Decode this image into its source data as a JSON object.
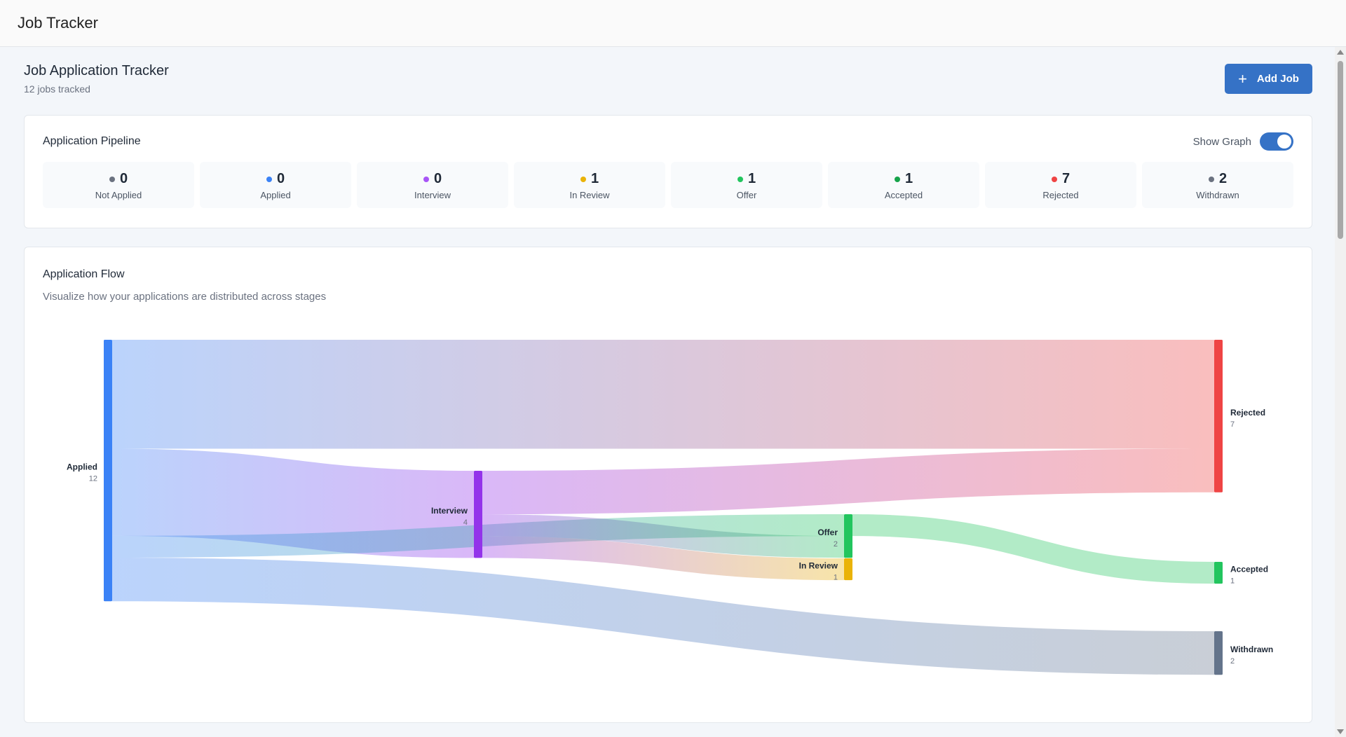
{
  "app": {
    "title": "Job Tracker"
  },
  "header": {
    "title": "Job Application Tracker",
    "subtitle": "12 jobs tracked",
    "add_button_label": "Add Job",
    "add_button_icon": "plus-icon"
  },
  "pipeline": {
    "title": "Application Pipeline",
    "toggle_label": "Show Graph",
    "toggle_on": true,
    "stages": [
      {
        "label": "Not Applied",
        "count": "0",
        "color": "#6b7280"
      },
      {
        "label": "Applied",
        "count": "0",
        "color": "#3b82f6"
      },
      {
        "label": "Interview",
        "count": "0",
        "color": "#a855f7"
      },
      {
        "label": "In Review",
        "count": "1",
        "color": "#eab308"
      },
      {
        "label": "Offer",
        "count": "1",
        "color": "#22c55e"
      },
      {
        "label": "Accepted",
        "count": "1",
        "color": "#16a34a"
      },
      {
        "label": "Rejected",
        "count": "7",
        "color": "#ef4444"
      },
      {
        "label": "Withdrawn",
        "count": "2",
        "color": "#6b7280"
      }
    ]
  },
  "flow": {
    "title": "Application Flow",
    "subtitle": "Visualize how your applications are distributed across stages"
  },
  "chart_data": {
    "type": "sankey",
    "nodes": [
      {
        "id": "applied",
        "name": "Applied",
        "value": 12,
        "color": "#3b82f6"
      },
      {
        "id": "interview",
        "name": "Interview",
        "value": 4,
        "color": "#9333ea"
      },
      {
        "id": "offer",
        "name": "Offer",
        "value": 2,
        "color": "#22c55e"
      },
      {
        "id": "inreview",
        "name": "In Review",
        "value": 1,
        "color": "#eab308"
      },
      {
        "id": "rejected",
        "name": "Rejected",
        "value": 7,
        "color": "#ef4444"
      },
      {
        "id": "accepted",
        "name": "Accepted",
        "value": 1,
        "color": "#22c55e"
      },
      {
        "id": "withdrawn",
        "name": "Withdrawn",
        "value": 2,
        "color": "#64748b"
      }
    ],
    "links": [
      {
        "source": "applied",
        "target": "rejected",
        "value": 5
      },
      {
        "source": "applied",
        "target": "interview",
        "value": 4
      },
      {
        "source": "applied",
        "target": "offer",
        "value": 1
      },
      {
        "source": "applied",
        "target": "withdrawn",
        "value": 2
      },
      {
        "source": "interview",
        "target": "rejected",
        "value": 2
      },
      {
        "source": "interview",
        "target": "offer",
        "value": 1
      },
      {
        "source": "interview",
        "target": "inreview",
        "value": 1
      },
      {
        "source": "offer",
        "target": "accepted",
        "value": 1
      },
      {
        "source": "offer",
        "target": "withdrawn",
        "value": 0
      }
    ]
  }
}
